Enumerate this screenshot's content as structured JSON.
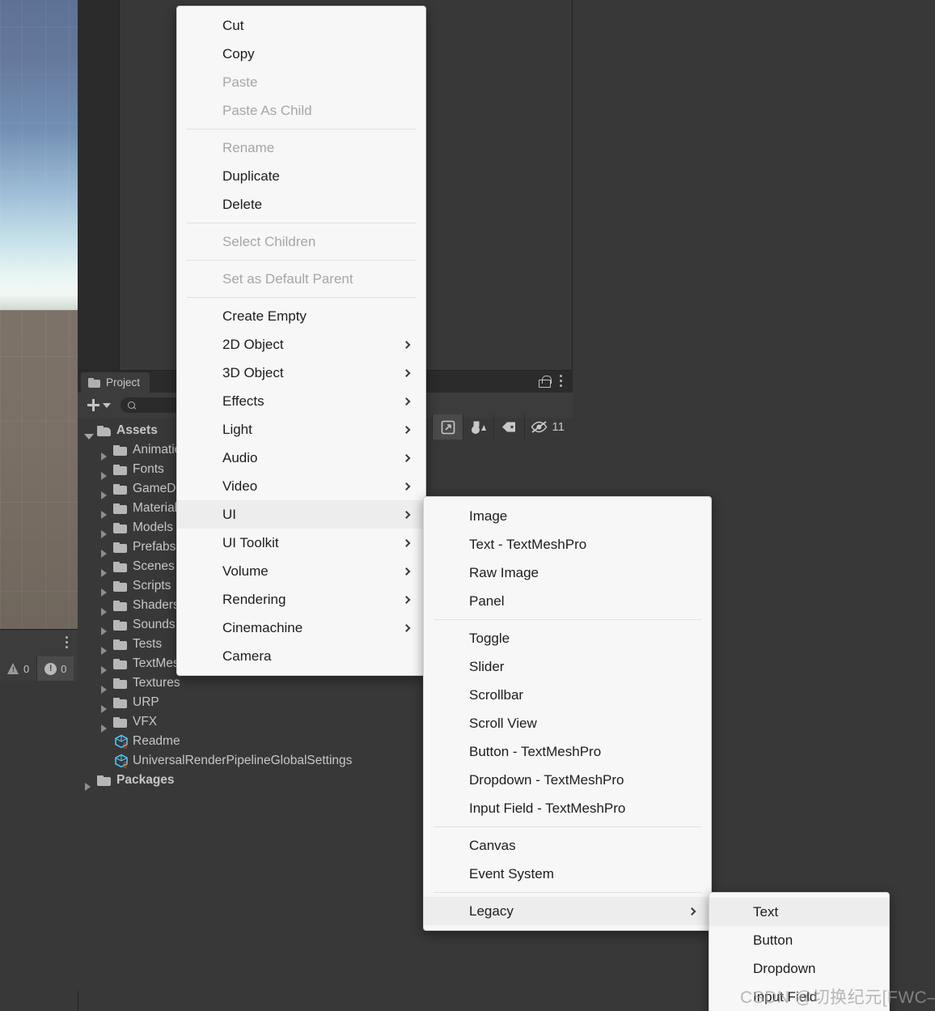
{
  "scene": {
    "name": "scene-view"
  },
  "console": {
    "warning_count": "0",
    "error_count": "0"
  },
  "project_panel": {
    "tab_label": "Project",
    "search_placeholder": "",
    "hidden_count": "11",
    "tree": [
      {
        "label": "Assets",
        "level": 0,
        "icon": "folder-open",
        "expanded": true
      },
      {
        "label": "Animations",
        "level": 1,
        "icon": "folder",
        "expanded": false
      },
      {
        "label": "Fonts",
        "level": 1,
        "icon": "folder",
        "expanded": false
      },
      {
        "label": "GameData",
        "level": 1,
        "icon": "folder",
        "expanded": false
      },
      {
        "label": "Materials",
        "level": 1,
        "icon": "folder",
        "expanded": false
      },
      {
        "label": "Models",
        "level": 1,
        "icon": "folder",
        "expanded": false
      },
      {
        "label": "Prefabs",
        "level": 1,
        "icon": "folder",
        "expanded": false
      },
      {
        "label": "Scenes",
        "level": 1,
        "icon": "folder",
        "expanded": false
      },
      {
        "label": "Scripts",
        "level": 1,
        "icon": "folder",
        "expanded": false
      },
      {
        "label": "Shaders",
        "level": 1,
        "icon": "folder",
        "expanded": false
      },
      {
        "label": "Sounds",
        "level": 1,
        "icon": "folder",
        "expanded": false
      },
      {
        "label": "Tests",
        "level": 1,
        "icon": "folder",
        "expanded": false
      },
      {
        "label": "TextMesh Pro",
        "level": 1,
        "icon": "folder",
        "expanded": false
      },
      {
        "label": "Textures",
        "level": 1,
        "icon": "folder",
        "expanded": false
      },
      {
        "label": "URP",
        "level": 1,
        "icon": "folder",
        "expanded": false
      },
      {
        "label": "VFX",
        "level": 1,
        "icon": "folder",
        "expanded": false
      },
      {
        "label": "Readme",
        "level": 1,
        "icon": "asset",
        "expanded": false
      },
      {
        "label": "UniversalRenderPipelineGlobalSettings",
        "level": 1,
        "icon": "asset",
        "expanded": false
      },
      {
        "label": "Packages",
        "level": 0,
        "icon": "folder",
        "expanded": false
      }
    ]
  },
  "context_menu": {
    "items": [
      {
        "label": "Cut",
        "state": "normal",
        "submenu": false
      },
      {
        "label": "Copy",
        "state": "normal",
        "submenu": false
      },
      {
        "label": "Paste",
        "state": "disabled",
        "submenu": false
      },
      {
        "label": "Paste As Child",
        "state": "disabled",
        "submenu": false
      },
      {
        "separator": true
      },
      {
        "label": "Rename",
        "state": "disabled",
        "submenu": false
      },
      {
        "label": "Duplicate",
        "state": "normal",
        "submenu": false
      },
      {
        "label": "Delete",
        "state": "normal",
        "submenu": false
      },
      {
        "separator": true
      },
      {
        "label": "Select Children",
        "state": "disabled",
        "submenu": false
      },
      {
        "separator": true
      },
      {
        "label": "Set as Default Parent",
        "state": "disabled",
        "submenu": false
      },
      {
        "separator": true
      },
      {
        "label": "Create Empty",
        "state": "normal",
        "submenu": false
      },
      {
        "label": "2D Object",
        "state": "normal",
        "submenu": true
      },
      {
        "label": "3D Object",
        "state": "normal",
        "submenu": true
      },
      {
        "label": "Effects",
        "state": "normal",
        "submenu": true
      },
      {
        "label": "Light",
        "state": "normal",
        "submenu": true
      },
      {
        "label": "Audio",
        "state": "normal",
        "submenu": true
      },
      {
        "label": "Video",
        "state": "normal",
        "submenu": true
      },
      {
        "label": "UI",
        "state": "highlighted",
        "submenu": true
      },
      {
        "label": "UI Toolkit",
        "state": "normal",
        "submenu": true
      },
      {
        "label": "Volume",
        "state": "normal",
        "submenu": true
      },
      {
        "label": "Rendering",
        "state": "normal",
        "submenu": true
      },
      {
        "label": "Cinemachine",
        "state": "normal",
        "submenu": true
      },
      {
        "label": "Camera",
        "state": "normal",
        "submenu": false
      }
    ]
  },
  "ui_submenu": {
    "items": [
      {
        "label": "Image",
        "state": "normal",
        "submenu": false
      },
      {
        "label": "Text - TextMeshPro",
        "state": "normal",
        "submenu": false
      },
      {
        "label": "Raw Image",
        "state": "normal",
        "submenu": false
      },
      {
        "label": "Panel",
        "state": "normal",
        "submenu": false
      },
      {
        "separator": true
      },
      {
        "label": "Toggle",
        "state": "normal",
        "submenu": false
      },
      {
        "label": "Slider",
        "state": "normal",
        "submenu": false
      },
      {
        "label": "Scrollbar",
        "state": "normal",
        "submenu": false
      },
      {
        "label": "Scroll View",
        "state": "normal",
        "submenu": false
      },
      {
        "label": "Button - TextMeshPro",
        "state": "normal",
        "submenu": false
      },
      {
        "label": "Dropdown - TextMeshPro",
        "state": "normal",
        "submenu": false
      },
      {
        "label": "Input Field - TextMeshPro",
        "state": "normal",
        "submenu": false
      },
      {
        "separator": true
      },
      {
        "label": "Canvas",
        "state": "normal",
        "submenu": false
      },
      {
        "label": "Event System",
        "state": "normal",
        "submenu": false
      },
      {
        "separator": true
      },
      {
        "label": "Legacy",
        "state": "highlighted",
        "submenu": true
      }
    ]
  },
  "legacy_submenu": {
    "items": [
      {
        "label": "Text",
        "state": "highlighted",
        "submenu": false
      },
      {
        "label": "Button",
        "state": "normal",
        "submenu": false
      },
      {
        "label": "Dropdown",
        "state": "normal",
        "submenu": false
      },
      {
        "label": "Input Field",
        "state": "normal",
        "submenu": false
      }
    ]
  },
  "watermark": {
    "text": "CSDN @切换纪元[FWC—FE]"
  },
  "colors": {
    "editor_background": "#383838",
    "panel_header": "#3c3c3c",
    "menu_background": "#f7f7f7",
    "menu_highlight": "#ededed",
    "menu_text": "#1d1d1d",
    "menu_disabled_text": "#a6a6a6",
    "tree_text": "#c7c7c7",
    "asset_icon": "#4ec3f0"
  }
}
